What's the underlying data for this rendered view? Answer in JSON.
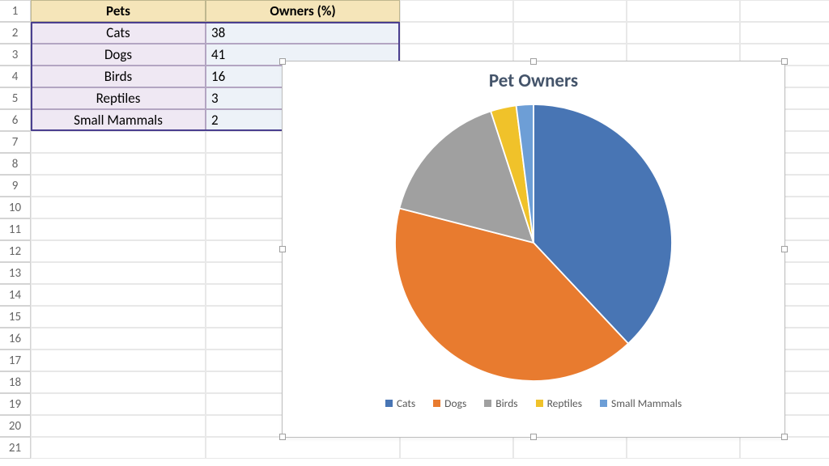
{
  "headers": {
    "col_a": "Pets",
    "col_b": "Owners (%)"
  },
  "rows": [
    {
      "label": "Cats",
      "value": "38"
    },
    {
      "label": "Dogs",
      "value": "41"
    },
    {
      "label": "Birds",
      "value": "16"
    },
    {
      "label": "Reptiles",
      "value": "3"
    },
    {
      "label": "Small Mammals",
      "value": "2"
    }
  ],
  "row_numbers": [
    "1",
    "2",
    "3",
    "4",
    "5",
    "6",
    "7",
    "8",
    "9",
    "10",
    "11",
    "12",
    "13",
    "14",
    "15",
    "16",
    "17",
    "18",
    "19",
    "20",
    "21"
  ],
  "chart_data": {
    "type": "pie",
    "title": "Pet Owners",
    "categories": [
      "Cats",
      "Dogs",
      "Birds",
      "Reptiles",
      "Small Mammals"
    ],
    "values": [
      38,
      41,
      16,
      3,
      2
    ],
    "colors": [
      "#4875b4",
      "#e87b2f",
      "#a0a0a0",
      "#f0c22a",
      "#6d9ed6"
    ]
  }
}
